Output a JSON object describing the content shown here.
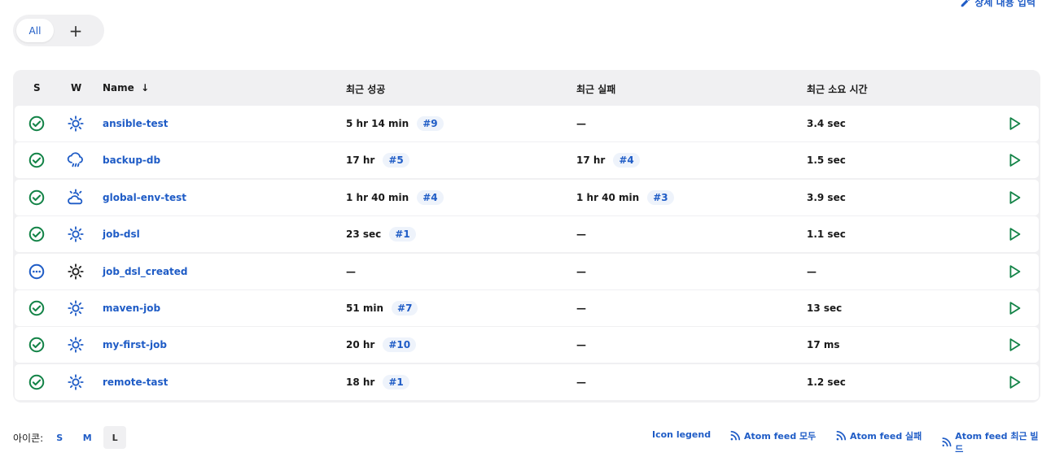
{
  "header": {
    "edit_description": "상세 내용 입력"
  },
  "tabs": {
    "all": "All",
    "add": "+"
  },
  "table": {
    "columns": {
      "s": "S",
      "w": "W",
      "name": "Name",
      "sort": "↓",
      "last_success": "최근 성공",
      "last_failure": "최근 실패",
      "last_duration": "최근 소요 시간"
    },
    "rows": [
      {
        "status": "success",
        "weather": "sunny",
        "name": "ansible-test",
        "success_time": "5 hr 14 min",
        "success_build": "#9",
        "failure_time": "—",
        "failure_build": "",
        "duration": "3.4 sec"
      },
      {
        "status": "success",
        "weather": "rainy",
        "name": "backup-db",
        "success_time": "17 hr",
        "success_build": "#5",
        "failure_time": "17 hr",
        "failure_build": "#4",
        "duration": "1.5 sec"
      },
      {
        "status": "success",
        "weather": "partly-cloudy",
        "name": "global-env-test",
        "success_time": "1 hr 40 min",
        "success_build": "#4",
        "failure_time": "1 hr 40 min",
        "failure_build": "#3",
        "duration": "3.9 sec"
      },
      {
        "status": "success",
        "weather": "sunny",
        "name": "job-dsl",
        "success_time": "23 sec",
        "success_build": "#1",
        "failure_time": "—",
        "failure_build": "",
        "duration": "1.1 sec"
      },
      {
        "status": "not-built",
        "weather": "sunny-dark",
        "name": "job_dsl_created",
        "success_time": "—",
        "success_build": "",
        "failure_time": "—",
        "failure_build": "",
        "duration": "—"
      },
      {
        "status": "success",
        "weather": "sunny",
        "name": "maven-job",
        "success_time": "51 min",
        "success_build": "#7",
        "failure_time": "—",
        "failure_build": "",
        "duration": "13 sec"
      },
      {
        "status": "success",
        "weather": "sunny",
        "name": "my-first-job",
        "success_time": "20 hr",
        "success_build": "#10",
        "failure_time": "—",
        "failure_build": "",
        "duration": "17 ms"
      },
      {
        "status": "success",
        "weather": "sunny",
        "name": "remote-tast",
        "success_time": "18 hr",
        "success_build": "#1",
        "failure_time": "—",
        "failure_build": "",
        "duration": "1.2 sec"
      }
    ]
  },
  "footer": {
    "icon_label": "아이콘:",
    "sizes": [
      "S",
      "M",
      "L"
    ],
    "icon_legend": "Icon legend",
    "feed_all": "Atom feed 모두",
    "feed_fail": "Atom feed 실패",
    "feed_latest": "Atom feed 최근 빌드"
  },
  "colors": {
    "link": "#1f5cc6",
    "success": "#138347",
    "run": "#138347"
  }
}
